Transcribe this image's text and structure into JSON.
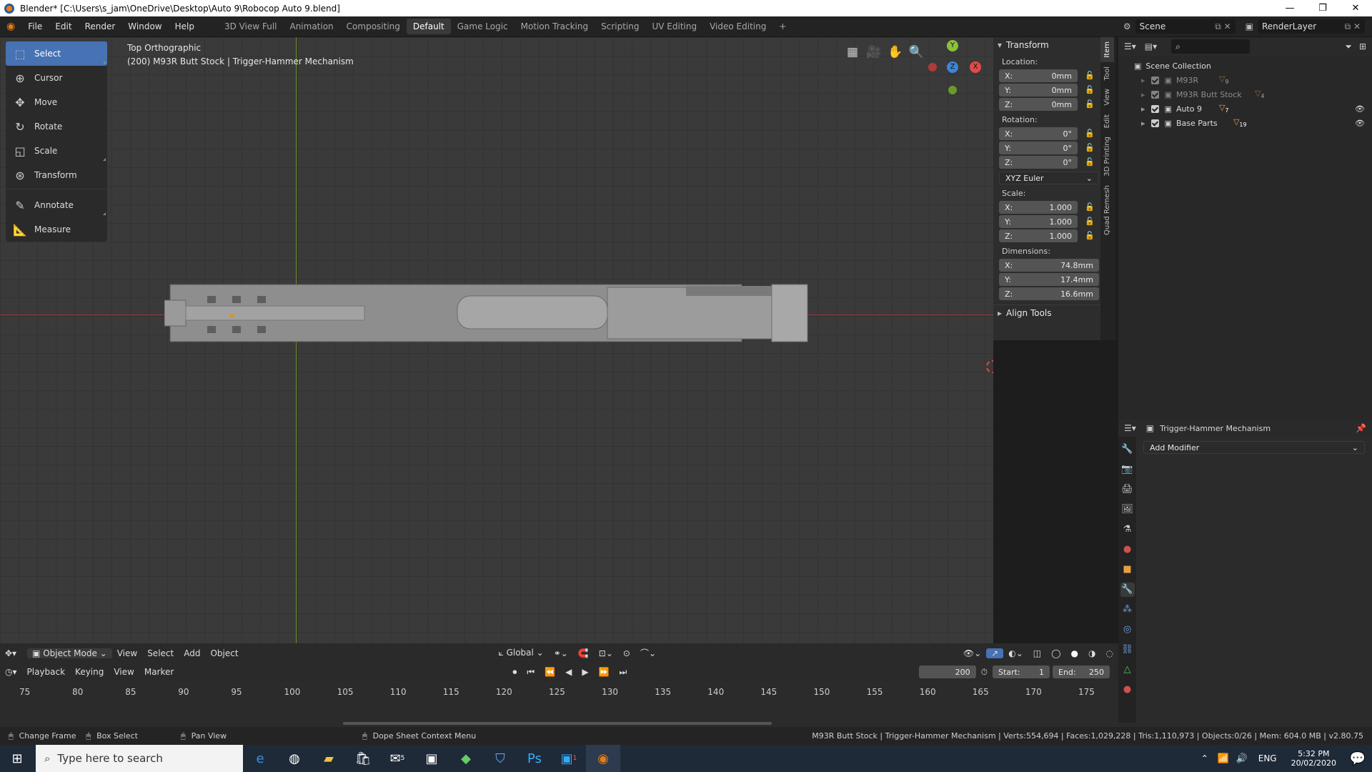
{
  "window": {
    "title": "Blender* [C:\\Users\\s_jam\\OneDrive\\Desktop\\Auto 9\\Robocop Auto 9.blend]",
    "minimize": "—",
    "maximize": "❐",
    "close": "✕"
  },
  "menu": {
    "items": [
      "File",
      "Edit",
      "Render",
      "Window",
      "Help"
    ],
    "workspaces": [
      "3D View Full",
      "Animation",
      "Compositing",
      "Default",
      "Game Logic",
      "Motion Tracking",
      "Scripting",
      "UV Editing",
      "Video Editing"
    ],
    "active_workspace": "Default",
    "add_workspace": "+",
    "scene": "Scene",
    "render_layer": "RenderLayer"
  },
  "viewport": {
    "view_name": "Top Orthographic",
    "object_info": "(200) M93R Butt Stock | Trigger-Hammer Mechanism",
    "tools": [
      {
        "label": "Select",
        "icon": "select-box-icon"
      },
      {
        "label": "Cursor",
        "icon": "cursor-icon"
      },
      {
        "label": "Move",
        "icon": "move-icon"
      },
      {
        "label": "Rotate",
        "icon": "rotate-icon"
      },
      {
        "label": "Scale",
        "icon": "scale-icon"
      },
      {
        "label": "Transform",
        "icon": "transform-icon"
      },
      {
        "label": "Annotate",
        "icon": "annotate-icon"
      },
      {
        "label": "Measure",
        "icon": "measure-icon"
      }
    ],
    "gizmo": {
      "y": "Y",
      "z": "Z",
      "x": "X"
    }
  },
  "npanel": {
    "tabs": [
      "Item",
      "Tool",
      "View",
      "Edit",
      "3D Printing",
      "Quad Remesh"
    ],
    "transform_title": "Transform",
    "location_label": "Location:",
    "location": {
      "x": "0mm",
      "y": "0mm",
      "z": "0mm"
    },
    "rotation_label": "Rotation:",
    "rotation": {
      "x": "0°",
      "y": "0°",
      "z": "0°"
    },
    "rotation_mode": "XYZ Euler",
    "scale_label": "Scale:",
    "scale": {
      "x": "1.000",
      "y": "1.000",
      "z": "1.000"
    },
    "dimensions_label": "Dimensions:",
    "dimensions": {
      "x": "74.8mm",
      "y": "17.4mm",
      "z": "16.6mm"
    },
    "axis": {
      "x": "X:",
      "y": "Y:",
      "z": "Z:"
    },
    "align_tools": "Align Tools"
  },
  "outliner": {
    "root": "Scene Collection",
    "collections": [
      {
        "name": "M93R",
        "badge": "9",
        "dim": true
      },
      {
        "name": "M93R Butt Stock",
        "badge": "4",
        "dim": true
      },
      {
        "name": "Auto 9",
        "badge": "7",
        "dim": false
      },
      {
        "name": "Base Parts",
        "badge": "19",
        "dim": false
      }
    ]
  },
  "properties": {
    "object_name": "Trigger-Hammer Mechanism",
    "add_modifier": "Add Modifier"
  },
  "viewport_header": {
    "mode": "Object Mode",
    "menus": [
      "View",
      "Select",
      "Add",
      "Object"
    ],
    "orientation": "Global"
  },
  "timeline": {
    "menus": [
      "Playback",
      "Keying",
      "View",
      "Marker"
    ],
    "current_frame": "200",
    "start_label": "Start:",
    "start": "1",
    "end_label": "End:",
    "end": "250",
    "ruler": [
      "75",
      "80",
      "85",
      "90",
      "95",
      "100",
      "105",
      "110",
      "115",
      "120",
      "125",
      "130",
      "135",
      "140",
      "145",
      "150",
      "155",
      "160",
      "165",
      "170",
      "175"
    ]
  },
  "status": {
    "change_frame": "Change Frame",
    "box_select": "Box Select",
    "pan_view": "Pan View",
    "context_menu": "Dope Sheet Context Menu",
    "stats": "M93R Butt Stock | Trigger-Hammer Mechanism | Verts:554,694 | Faces:1,029,228 | Tris:1,110,973 | Objects:0/26 | Mem: 604.0 MB | v2.80.75"
  },
  "taskbar": {
    "search_placeholder": "Type here to search",
    "language": "ENG",
    "time": "5:32 PM",
    "date": "20/02/2020",
    "mail_badge": "5",
    "app_badge": "1"
  },
  "colors": {
    "accent": "#4772b3",
    "x_axis": "#e44a4a",
    "y_axis": "#8bc13a",
    "z_axis": "#3d85d6",
    "blender_orange": "#e87d0d"
  }
}
